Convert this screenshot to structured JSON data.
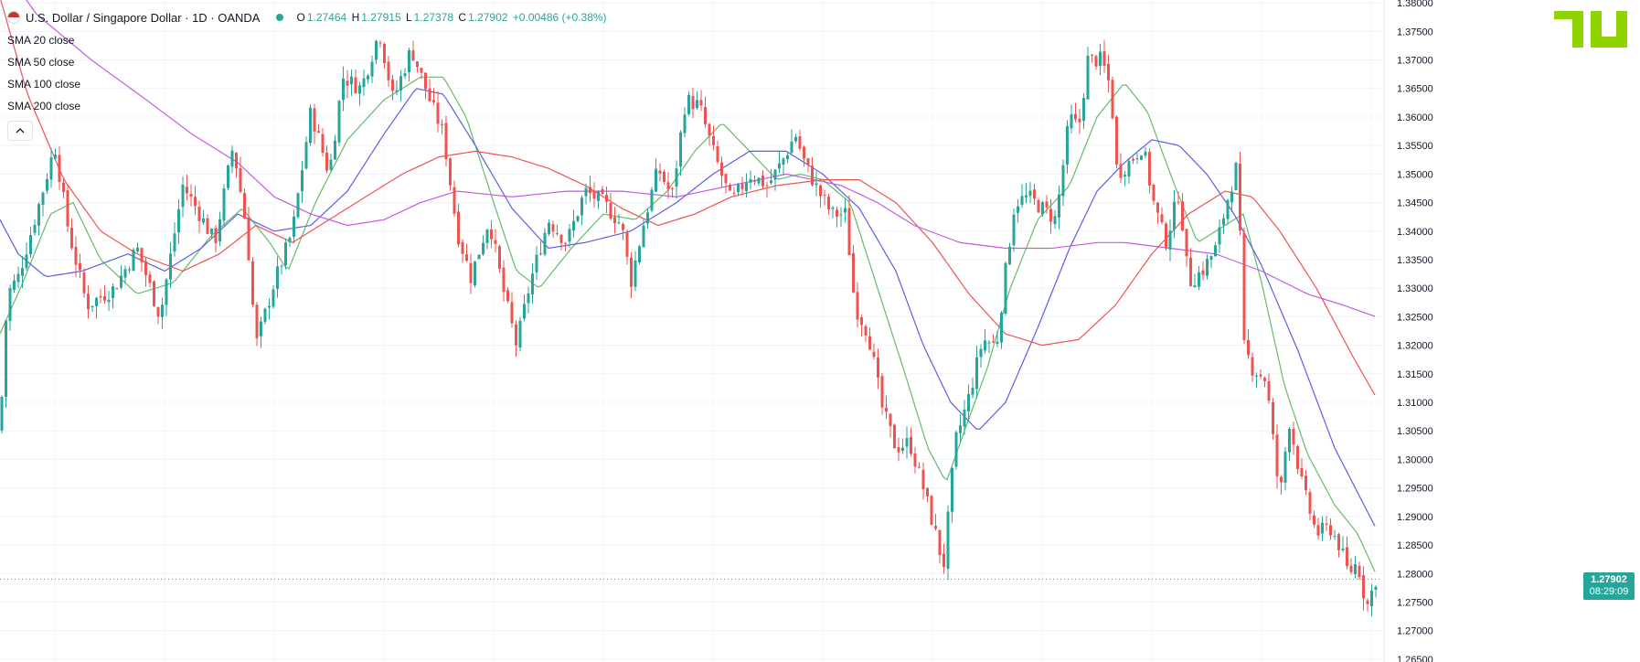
{
  "header": {
    "symbol_title": "U.S. Dollar / Singapore Dollar · 1D · OANDA",
    "ohlc": {
      "o_label": "O",
      "o_value": "1.27464",
      "h_label": "H",
      "h_value": "1.27915",
      "l_label": "L",
      "l_value": "1.27378",
      "c_label": "C",
      "c_value": "1.27902",
      "change": "+0.00486 (+0.38%)"
    },
    "collapse_icon": "chevron-up-icon"
  },
  "indicators": [
    {
      "label": "SMA 20 close",
      "color": "#66bb6a"
    },
    {
      "label": "SMA 50 close",
      "color": "#5b5fe6"
    },
    {
      "label": "SMA 100 close",
      "color": "#ef5350"
    },
    {
      "label": "SMA 200 close",
      "color": "#c65be0"
    }
  ],
  "last_price": {
    "value": "1.27902",
    "countdown": "08:29:09"
  },
  "colors": {
    "up": "#26a69a",
    "down": "#ef5350",
    "brand": "#8fd400"
  },
  "chart_data": {
    "type": "candlestick",
    "interval": "1D",
    "y_axis_ticks": [
      "1.38000",
      "1.37500",
      "1.37000",
      "1.36500",
      "1.36000",
      "1.35500",
      "1.35000",
      "1.34500",
      "1.34000",
      "1.33500",
      "1.33000",
      "1.32500",
      "1.32000",
      "1.31500",
      "1.31000",
      "1.30500",
      "1.30000",
      "1.29500",
      "1.29000",
      "1.28500",
      "1.28000",
      "1.27500",
      "1.27000",
      "1.26500"
    ],
    "ylim": [
      1.2645,
      1.3805
    ],
    "grid": true,
    "price_path": [
      [
        0,
        1.305
      ],
      [
        8,
        1.329
      ],
      [
        20,
        1.332
      ],
      [
        45,
        1.346
      ],
      [
        60,
        1.355
      ],
      [
        75,
        1.34
      ],
      [
        95,
        1.327
      ],
      [
        125,
        1.33
      ],
      [
        150,
        1.337
      ],
      [
        175,
        1.325
      ],
      [
        200,
        1.348
      ],
      [
        215,
        1.344
      ],
      [
        235,
        1.338
      ],
      [
        255,
        1.355
      ],
      [
        270,
        1.34
      ],
      [
        280,
        1.32
      ],
      [
        300,
        1.331
      ],
      [
        320,
        1.34
      ],
      [
        340,
        1.361
      ],
      [
        360,
        1.35
      ],
      [
        375,
        1.367
      ],
      [
        395,
        1.365
      ],
      [
        415,
        1.375
      ],
      [
        430,
        1.363
      ],
      [
        450,
        1.372
      ],
      [
        470,
        1.363
      ],
      [
        485,
        1.357
      ],
      [
        500,
        1.34
      ],
      [
        515,
        1.332
      ],
      [
        535,
        1.342
      ],
      [
        550,
        1.33
      ],
      [
        565,
        1.32
      ],
      [
        580,
        1.331
      ],
      [
        600,
        1.342
      ],
      [
        620,
        1.338
      ],
      [
        640,
        1.347
      ],
      [
        660,
        1.345
      ],
      [
        680,
        1.341
      ],
      [
        690,
        1.331
      ],
      [
        705,
        1.342
      ],
      [
        720,
        1.351
      ],
      [
        735,
        1.346
      ],
      [
        750,
        1.363
      ],
      [
        765,
        1.362
      ],
      [
        780,
        1.354
      ],
      [
        800,
        1.345
      ],
      [
        820,
        1.35
      ],
      [
        840,
        1.348
      ],
      [
        855,
        1.352
      ],
      [
        870,
        1.357
      ],
      [
        880,
        1.352
      ],
      [
        895,
        1.347
      ],
      [
        910,
        1.343
      ],
      [
        925,
        1.343
      ],
      [
        935,
        1.327
      ],
      [
        950,
        1.322
      ],
      [
        965,
        1.309
      ],
      [
        980,
        1.302
      ],
      [
        995,
        1.303
      ],
      [
        1010,
        1.295
      ],
      [
        1025,
        1.286
      ],
      [
        1032,
        1.281
      ],
      [
        1045,
        1.303
      ],
      [
        1060,
        1.311
      ],
      [
        1075,
        1.321
      ],
      [
        1090,
        1.32
      ],
      [
        1100,
        1.333
      ],
      [
        1110,
        1.345
      ],
      [
        1125,
        1.346
      ],
      [
        1140,
        1.344
      ],
      [
        1155,
        1.342
      ],
      [
        1170,
        1.36
      ],
      [
        1180,
        1.358
      ],
      [
        1190,
        1.37
      ],
      [
        1205,
        1.37
      ],
      [
        1215,
        1.365
      ],
      [
        1222,
        1.35
      ],
      [
        1235,
        1.352
      ],
      [
        1250,
        1.355
      ],
      [
        1262,
        1.345
      ],
      [
        1275,
        1.338
      ],
      [
        1290,
        1.347
      ],
      [
        1300,
        1.331
      ],
      [
        1315,
        1.333
      ],
      [
        1330,
        1.337
      ],
      [
        1345,
        1.347
      ],
      [
        1354,
        1.352
      ],
      [
        1360,
        1.32
      ],
      [
        1370,
        1.316
      ],
      [
        1385,
        1.314
      ],
      [
        1400,
        1.293
      ],
      [
        1410,
        1.307
      ],
      [
        1425,
        1.295
      ],
      [
        1440,
        1.287
      ],
      [
        1455,
        1.288
      ],
      [
        1465,
        1.285
      ],
      [
        1475,
        1.28
      ],
      [
        1485,
        1.282
      ],
      [
        1495,
        1.274
      ],
      [
        1505,
        1.279
      ]
    ],
    "sma_paths": {
      "sma20": [
        [
          0,
          1.322
        ],
        [
          25,
          1.331
        ],
        [
          55,
          1.343
        ],
        [
          80,
          1.345
        ],
        [
          110,
          1.335
        ],
        [
          150,
          1.329
        ],
        [
          190,
          1.331
        ],
        [
          230,
          1.339
        ],
        [
          265,
          1.344
        ],
        [
          295,
          1.338
        ],
        [
          315,
          1.333
        ],
        [
          345,
          1.345
        ],
        [
          380,
          1.356
        ],
        [
          420,
          1.363
        ],
        [
          460,
          1.367
        ],
        [
          485,
          1.367
        ],
        [
          510,
          1.36
        ],
        [
          540,
          1.345
        ],
        [
          565,
          1.333
        ],
        [
          590,
          1.33
        ],
        [
          625,
          1.337
        ],
        [
          660,
          1.343
        ],
        [
          695,
          1.342
        ],
        [
          730,
          1.347
        ],
        [
          760,
          1.354
        ],
        [
          790,
          1.359
        ],
        [
          820,
          1.354
        ],
        [
          850,
          1.349
        ],
        [
          875,
          1.35
        ],
        [
          900,
          1.349
        ],
        [
          930,
          1.345
        ],
        [
          960,
          1.33
        ],
        [
          990,
          1.315
        ],
        [
          1015,
          1.302
        ],
        [
          1035,
          1.296
        ],
        [
          1055,
          1.305
        ],
        [
          1080,
          1.316
        ],
        [
          1105,
          1.33
        ],
        [
          1135,
          1.342
        ],
        [
          1170,
          1.348
        ],
        [
          1200,
          1.36
        ],
        [
          1230,
          1.366
        ],
        [
          1255,
          1.361
        ],
        [
          1285,
          1.348
        ],
        [
          1310,
          1.338
        ],
        [
          1340,
          1.341
        ],
        [
          1360,
          1.343
        ],
        [
          1380,
          1.331
        ],
        [
          1405,
          1.313
        ],
        [
          1430,
          1.301
        ],
        [
          1460,
          1.292
        ],
        [
          1485,
          1.287
        ],
        [
          1505,
          1.28
        ]
      ],
      "sma50": [
        [
          0,
          1.342
        ],
        [
          20,
          1.336
        ],
        [
          50,
          1.332
        ],
        [
          90,
          1.333
        ],
        [
          140,
          1.336
        ],
        [
          180,
          1.333
        ],
        [
          220,
          1.337
        ],
        [
          260,
          1.343
        ],
        [
          300,
          1.34
        ],
        [
          340,
          1.341
        ],
        [
          380,
          1.347
        ],
        [
          420,
          1.357
        ],
        [
          455,
          1.365
        ],
        [
          485,
          1.364
        ],
        [
          520,
          1.355
        ],
        [
          560,
          1.344
        ],
        [
          600,
          1.337
        ],
        [
          640,
          1.338
        ],
        [
          690,
          1.34
        ],
        [
          740,
          1.345
        ],
        [
          780,
          1.35
        ],
        [
          820,
          1.354
        ],
        [
          860,
          1.354
        ],
        [
          900,
          1.35
        ],
        [
          940,
          1.344
        ],
        [
          980,
          1.333
        ],
        [
          1010,
          1.32
        ],
        [
          1040,
          1.31
        ],
        [
          1070,
          1.305
        ],
        [
          1100,
          1.31
        ],
        [
          1135,
          1.323
        ],
        [
          1170,
          1.337
        ],
        [
          1200,
          1.347
        ],
        [
          1230,
          1.352
        ],
        [
          1260,
          1.356
        ],
        [
          1290,
          1.355
        ],
        [
          1320,
          1.35
        ],
        [
          1350,
          1.343
        ],
        [
          1380,
          1.334
        ],
        [
          1420,
          1.319
        ],
        [
          1460,
          1.302
        ],
        [
          1505,
          1.288
        ]
      ],
      "sma100": [
        [
          0,
          1.381
        ],
        [
          30,
          1.364
        ],
        [
          70,
          1.349
        ],
        [
          110,
          1.34
        ],
        [
          150,
          1.336
        ],
        [
          200,
          1.333
        ],
        [
          240,
          1.336
        ],
        [
          280,
          1.341
        ],
        [
          320,
          1.338
        ],
        [
          360,
          1.342
        ],
        [
          400,
          1.346
        ],
        [
          440,
          1.35
        ],
        [
          480,
          1.353
        ],
        [
          520,
          1.354
        ],
        [
          560,
          1.353
        ],
        [
          600,
          1.351
        ],
        [
          640,
          1.348
        ],
        [
          680,
          1.344
        ],
        [
          720,
          1.341
        ],
        [
          760,
          1.343
        ],
        [
          800,
          1.346
        ],
        [
          850,
          1.348
        ],
        [
          900,
          1.349
        ],
        [
          940,
          1.349
        ],
        [
          980,
          1.345
        ],
        [
          1020,
          1.338
        ],
        [
          1060,
          1.329
        ],
        [
          1100,
          1.322
        ],
        [
          1140,
          1.32
        ],
        [
          1180,
          1.321
        ],
        [
          1220,
          1.327
        ],
        [
          1260,
          1.336
        ],
        [
          1300,
          1.343
        ],
        [
          1340,
          1.347
        ],
        [
          1370,
          1.346
        ],
        [
          1400,
          1.34
        ],
        [
          1440,
          1.33
        ],
        [
          1480,
          1.318
        ],
        [
          1505,
          1.311
        ]
      ],
      "sma200": [
        [
          0,
          1.387
        ],
        [
          40,
          1.378
        ],
        [
          100,
          1.37
        ],
        [
          160,
          1.363
        ],
        [
          210,
          1.357
        ],
        [
          260,
          1.352
        ],
        [
          300,
          1.346
        ],
        [
          340,
          1.343
        ],
        [
          380,
          1.341
        ],
        [
          420,
          1.342
        ],
        [
          460,
          1.345
        ],
        [
          500,
          1.347
        ],
        [
          560,
          1.346
        ],
        [
          620,
          1.347
        ],
        [
          680,
          1.347
        ],
        [
          740,
          1.346
        ],
        [
          800,
          1.348
        ],
        [
          860,
          1.35
        ],
        [
          920,
          1.348
        ],
        [
          960,
          1.345
        ],
        [
          1000,
          1.341
        ],
        [
          1050,
          1.338
        ],
        [
          1100,
          1.337
        ],
        [
          1150,
          1.337
        ],
        [
          1200,
          1.338
        ],
        [
          1230,
          1.338
        ],
        [
          1280,
          1.337
        ],
        [
          1330,
          1.336
        ],
        [
          1380,
          1.333
        ],
        [
          1430,
          1.329
        ],
        [
          1470,
          1.327
        ],
        [
          1505,
          1.325
        ]
      ]
    }
  }
}
